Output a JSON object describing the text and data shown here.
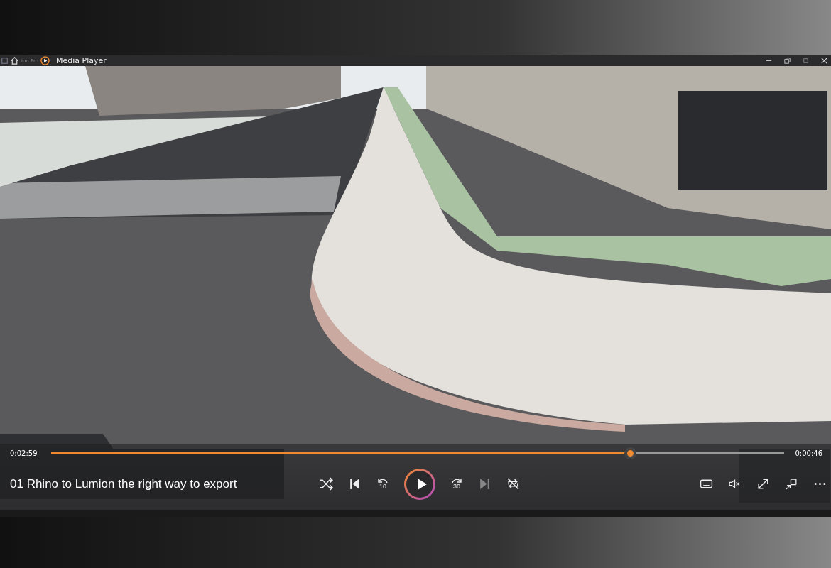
{
  "window": {
    "behind_title": "ion Pro",
    "title": "Media Player"
  },
  "player": {
    "elapsed": "0:02:59",
    "remaining": "0:00:46",
    "level": 0.79,
    "title": "01 Rhino to Lumion the right way to export",
    "transport": [
      {
        "kind": "shuffle",
        "disabled": false
      },
      {
        "kind": "previous",
        "disabled": false
      },
      {
        "kind": "back",
        "label": "10",
        "disabled": false
      },
      {
        "kind": "play",
        "disabled": false
      },
      {
        "kind": "forward",
        "label": "30",
        "disabled": false
      },
      {
        "kind": "next",
        "disabled": true
      },
      {
        "kind": "repeat",
        "disabled": false
      }
    ],
    "tools": [
      {
        "kind": "captions"
      },
      {
        "kind": "mute"
      },
      {
        "kind": "fullscreen"
      },
      {
        "kind": "miniplayer"
      },
      {
        "kind": "more"
      }
    ]
  }
}
